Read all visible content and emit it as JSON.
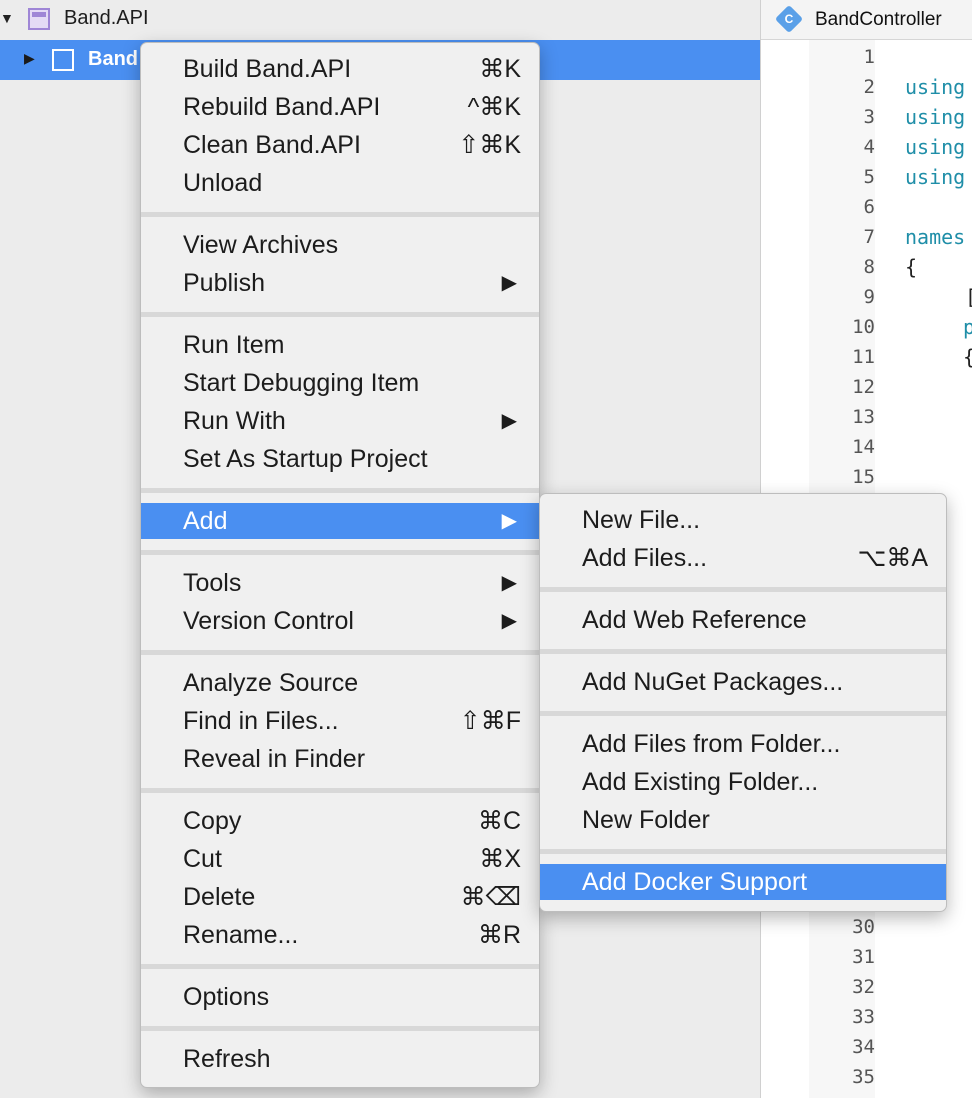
{
  "solution_pad": {
    "solution_label": "Band.API",
    "project_label": "Band"
  },
  "editor": {
    "tab_title": "BandController",
    "line_numbers": [
      "1",
      "2",
      "3",
      "4",
      "5",
      "6",
      "7",
      "8",
      "9",
      "10",
      "11",
      "12",
      "13",
      "14",
      "15",
      "30",
      "31",
      "32",
      "33",
      "34",
      "35"
    ],
    "code": {
      "l2": "using",
      "l3": "using",
      "l4": "using",
      "l5": "using",
      "l7": "names",
      "l8": "{",
      "l9": "[",
      "l10": "p",
      "l11": "{"
    }
  },
  "context_menu": {
    "build": {
      "label": "Build Band.API",
      "shortcut": "⌘K"
    },
    "rebuild": {
      "label": "Rebuild Band.API",
      "shortcut": "^⌘K"
    },
    "clean": {
      "label": "Clean Band.API",
      "shortcut": "⇧⌘K"
    },
    "unload": {
      "label": "Unload"
    },
    "view_archives": {
      "label": "View Archives"
    },
    "publish": {
      "label": "Publish"
    },
    "run_item": {
      "label": "Run Item"
    },
    "start_debugging": {
      "label": "Start Debugging Item"
    },
    "run_with": {
      "label": "Run With"
    },
    "set_startup": {
      "label": "Set As Startup Project"
    },
    "add": {
      "label": "Add"
    },
    "tools": {
      "label": "Tools"
    },
    "version_control": {
      "label": "Version Control"
    },
    "analyze_source": {
      "label": "Analyze Source"
    },
    "find_in_files": {
      "label": "Find in Files...",
      "shortcut": "⇧⌘F"
    },
    "reveal_in_finder": {
      "label": "Reveal in Finder"
    },
    "copy": {
      "label": "Copy",
      "shortcut": "⌘C"
    },
    "cut": {
      "label": "Cut",
      "shortcut": "⌘X"
    },
    "delete": {
      "label": "Delete",
      "shortcut": "⌘⌫"
    },
    "rename": {
      "label": "Rename...",
      "shortcut": "⌘R"
    },
    "options": {
      "label": "Options"
    },
    "refresh": {
      "label": "Refresh"
    },
    "submenu_arrow": "▶"
  },
  "add_submenu": {
    "new_file": {
      "label": "New File..."
    },
    "add_files": {
      "label": "Add Files...",
      "shortcut": "⌥⌘A"
    },
    "add_web_reference": {
      "label": "Add Web Reference"
    },
    "add_nuget": {
      "label": "Add NuGet Packages..."
    },
    "add_files_from_folder": {
      "label": "Add Files from Folder..."
    },
    "add_existing_folder": {
      "label": "Add Existing Folder..."
    },
    "new_folder": {
      "label": "New Folder"
    },
    "add_docker_support": {
      "label": "Add Docker Support"
    }
  },
  "icons": {
    "expanded": "▼",
    "collapsed": "▶",
    "csharp_letter": "C"
  },
  "colors": {
    "selection": "#4a8ff1",
    "keyword": "#1f8ea8"
  }
}
